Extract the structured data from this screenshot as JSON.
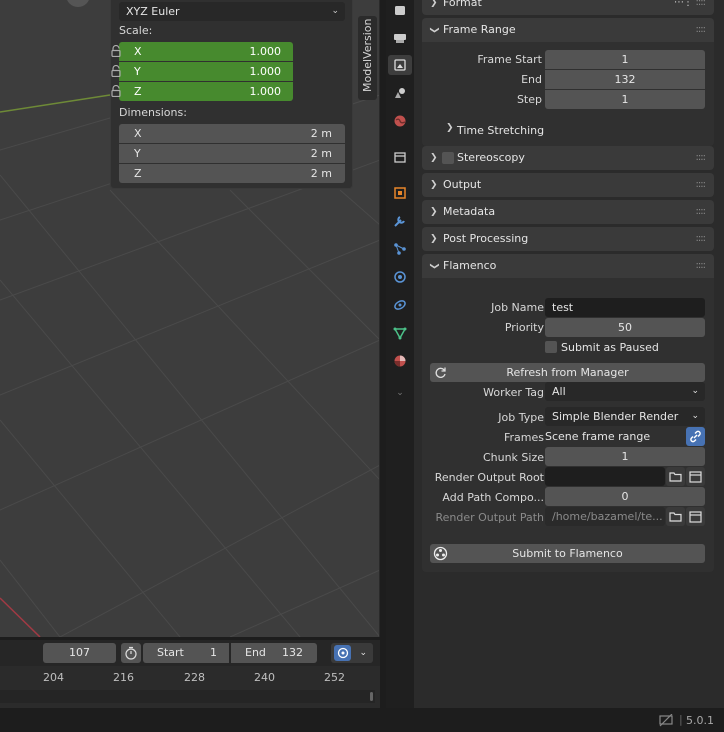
{
  "viewport": {
    "rotation_mode": "XYZ Euler",
    "scale_label": "Scale:",
    "scale": [
      {
        "axis": "X",
        "value": "1.000"
      },
      {
        "axis": "Y",
        "value": "1.000"
      },
      {
        "axis": "Z",
        "value": "1.000"
      }
    ],
    "dimensions_label": "Dimensions:",
    "dimensions": [
      {
        "axis": "X",
        "value": "2 m"
      },
      {
        "axis": "Y",
        "value": "2 m"
      },
      {
        "axis": "Z",
        "value": "2 m"
      }
    ],
    "sidebar_tab": "ModelVersion"
  },
  "timeline": {
    "current_frame": "107",
    "start_label": "Start",
    "start_value": "1",
    "end_label": "End",
    "end_value": "132",
    "ruler_ticks": [
      "204",
      "216",
      "228",
      "240",
      "252"
    ]
  },
  "status_bar": {
    "version": "5.0.1"
  },
  "properties": {
    "format_header": "Format",
    "frame_range": {
      "title": "Frame Range",
      "frame_start_label": "Frame Start",
      "frame_start": "1",
      "end_label": "End",
      "end": "132",
      "step_label": "Step",
      "step": "1",
      "time_stretching": "Time Stretching"
    },
    "stereoscopy": "Stereoscopy",
    "output": "Output",
    "metadata": "Metadata",
    "post_processing": "Post Processing",
    "flamenco": {
      "title": "Flamenco",
      "job_name_label": "Job Name",
      "job_name": "test",
      "priority_label": "Priority",
      "priority": "50",
      "submit_paused_label": "Submit as Paused",
      "refresh_button": "Refresh from Manager",
      "worker_tag_label": "Worker Tag",
      "worker_tag": "All",
      "job_type_label": "Job Type",
      "job_type": "Simple Blender Render",
      "frames_label": "Frames",
      "frames": "Scene frame range",
      "chunk_size_label": "Chunk Size",
      "chunk_size": "1",
      "render_output_root_label": "Render Output Root",
      "render_output_root": "",
      "add_path_components_label": "Add Path Compo...",
      "add_path_components": "0",
      "render_output_path_label": "Render Output Path",
      "render_output_path": "/home/bazamel/te...",
      "submit_button": "Submit to Flamenco"
    }
  },
  "colors": {
    "accent_green": "#478a2e",
    "link_blue": "#4772b3",
    "panel_bg": "#303030",
    "field_bg": "#545454"
  },
  "icons": [
    "lock-icon",
    "timer-icon",
    "keyframe-icon",
    "chevron-down-icon",
    "refresh-icon",
    "folder-icon",
    "file-browser-icon",
    "link-icon",
    "flamenco-icon",
    "grip-icon",
    "render-tab-icon",
    "output-tab-icon",
    "view-layer-tab-icon",
    "scene-tab-icon",
    "world-tab-icon",
    "collection-tab-icon",
    "object-tab-icon",
    "modifier-tab-icon",
    "particles-tab-icon",
    "physics-tab-icon",
    "constraints-tab-icon",
    "data-tab-icon",
    "material-tab-icon",
    "network-off-icon"
  ]
}
